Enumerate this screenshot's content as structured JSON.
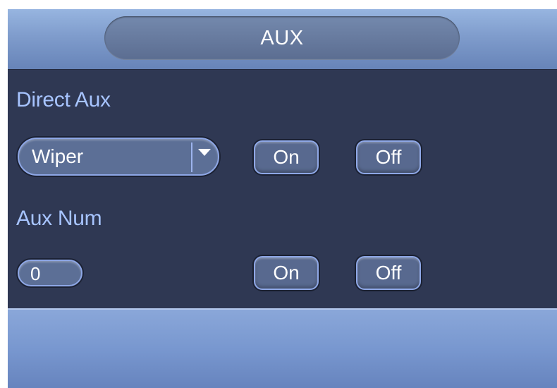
{
  "dialog": {
    "title": "AUX"
  },
  "direct_aux": {
    "label": "Direct Aux",
    "dropdown_value": "Wiper",
    "on_label": "On",
    "off_label": "Off"
  },
  "aux_num": {
    "label": "Aux Num",
    "input_value": "0",
    "on_label": "On",
    "off_label": "Off"
  },
  "colors": {
    "panel_bg": "#2f3853",
    "label": "#a7c4ff",
    "header_top": "#97b5e0",
    "footer": "#7897cf"
  },
  "icons": {
    "dropdown_arrow": "chevron-down-icon"
  }
}
